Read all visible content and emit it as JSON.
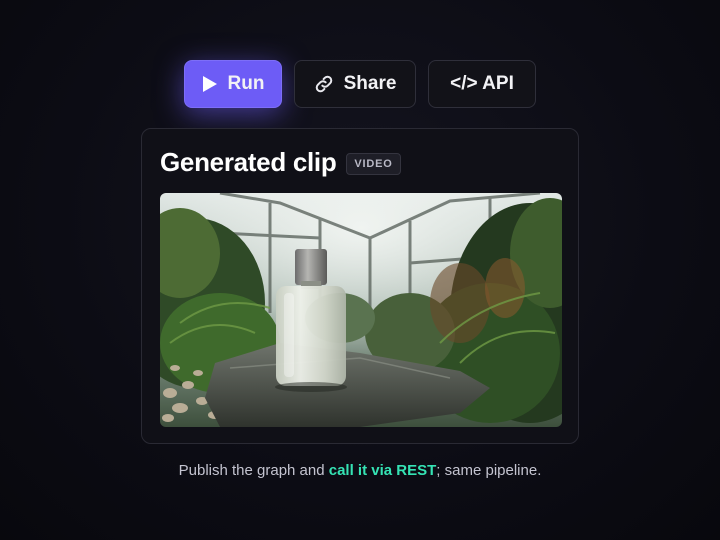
{
  "toolbar": {
    "run": {
      "label": "Run",
      "icon": "play-icon"
    },
    "share": {
      "label": "Share",
      "icon": "link-icon"
    },
    "api": {
      "label": "</> API"
    }
  },
  "card": {
    "title": "Generated clip",
    "badge": "VIDEO",
    "media": {
      "icon": "video-frame"
    }
  },
  "caption": {
    "prefix": "Publish the graph and ",
    "link": "call it via REST",
    "suffix": "; same pipeline."
  },
  "colors": {
    "accent": "#6d5cf6",
    "link": "#35e3b4",
    "background": "#0c0c14"
  }
}
